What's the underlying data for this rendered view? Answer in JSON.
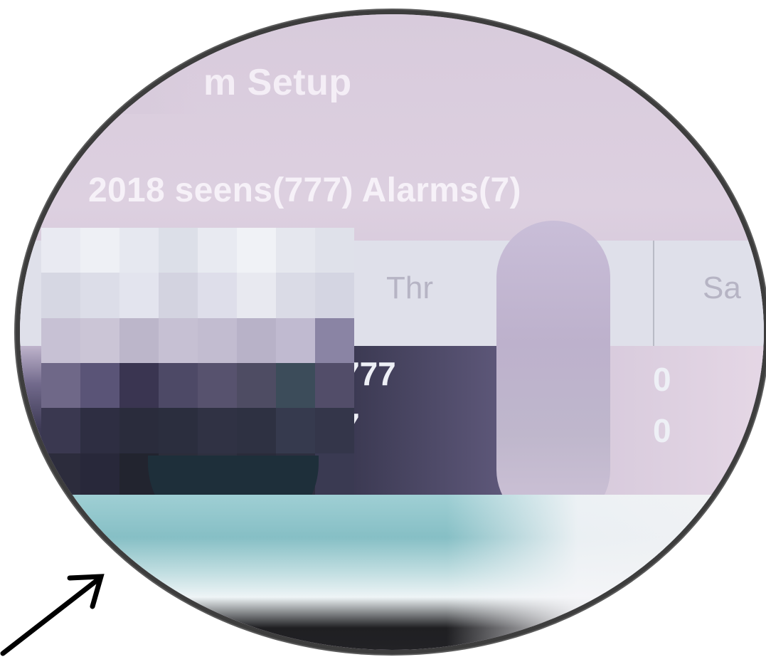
{
  "screen": {
    "title_fragment": "m Setup",
    "summary_fragment": "2018  seens(777) Alarms(7)"
  },
  "table": {
    "headers": [
      "Thr",
      "Sa"
    ],
    "rows": [
      {
        "thr": "777",
        "sa": "0"
      },
      {
        "thr": "7",
        "sa": "0"
      }
    ]
  },
  "colors": {
    "screen_bg": "#dccfe0",
    "header_bg": "#dfe0ea",
    "lens_border": "#3d3d3d",
    "arrow": "#000000"
  },
  "icons": {
    "pointer": "arrow-icon"
  }
}
